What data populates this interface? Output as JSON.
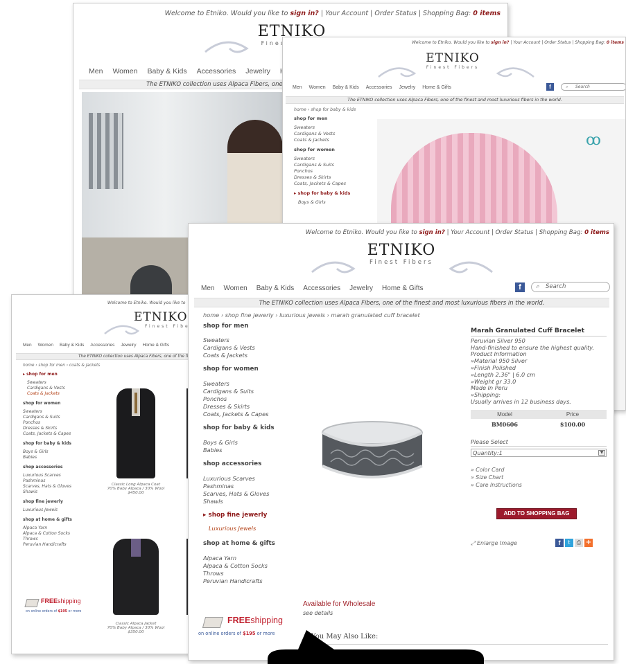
{
  "brand": {
    "name": "ETNIKO",
    "tagline": "Finest Fibers"
  },
  "topbar": {
    "welcome": "Welcome to Etniko. Would you like to",
    "signin": "sign in?",
    "account": "| Your Account | Order Status | Shopping Bag:",
    "bag_count": "0 items"
  },
  "nav": [
    "Men",
    "Women",
    "Baby & Kids",
    "Accessories",
    "Jewelry",
    "Home & Gifts"
  ],
  "search_placeholder": "Search",
  "banner": "The ETNIKO collection uses Alpaca Fibers, one of the finest and most luxurious fibers in the world.",
  "card_baby": {
    "breadcrumb": "home › shop for baby & kids",
    "sections": [
      {
        "title": "shop for men",
        "items": [
          "Sweaters",
          "Cardigans & Vests",
          "Coats & Jackets"
        ]
      },
      {
        "title": "shop for women",
        "items": [
          "Sweaters",
          "Cardigans & Suits",
          "Ponchos",
          "Dresses & Skirts",
          "Coats, Jackets & Capes"
        ]
      },
      {
        "title": "▸ shop for baby & kids",
        "items": [
          "Boys & Girls"
        ]
      }
    ]
  },
  "card_men": {
    "breadcrumb": "home › shop for men › coats & jackets",
    "sections": [
      {
        "title": "▸ shop for men",
        "items": [
          "Sweaters",
          "Cardigans & Vests",
          "Coats & Jackets"
        ]
      },
      {
        "title": "shop for women",
        "items": [
          "Sweaters",
          "Cardigans & Suits",
          "Ponchos",
          "Dresses & Skirts",
          "Coats, Jackets & Capes"
        ]
      },
      {
        "title": "shop for baby & kids",
        "items": [
          "Boys & Girls",
          "Babies"
        ]
      },
      {
        "title": "shop accessories",
        "items": [
          "Luxurious Scarves",
          "Pashminas",
          "Scarves, Hats & Gloves",
          "Shawls"
        ]
      },
      {
        "title": "shop fine jewerly",
        "items": [
          "Luxurious Jewels"
        ]
      },
      {
        "title": "shop at home & gifts",
        "items": [
          "Alpaca Yarn",
          "Alpaca & Cotton Socks",
          "Throws",
          "Peruvian Handicrafts"
        ]
      }
    ],
    "products": [
      {
        "name": "Classic Long Alpaca Coat",
        "desc": "70% Baby Alpaca / 30% Wool",
        "price": "$450.00"
      },
      {
        "name": "Classic Alpaca Jacket",
        "desc": "70% Baby Alpaca / 30% Wool",
        "price": "$350.00"
      }
    ]
  },
  "card_jewel": {
    "breadcrumb": "home › shop fine jewerly › luxurious jewels › marah granulated cuff bracelet",
    "sections": [
      {
        "title": "shop for men",
        "items": [
          "Sweaters",
          "Cardigans & Vests",
          "Coats & Jackets"
        ]
      },
      {
        "title": "shop for women",
        "items": [
          "Sweaters",
          "Cardigans & Suits",
          "Ponchos",
          "Dresses & Skirts",
          "Coats, Jackets & Capes"
        ]
      },
      {
        "title": "shop for baby & kids",
        "items": [
          "Boys & Girls",
          "Babies"
        ]
      },
      {
        "title": "shop accessories",
        "items": [
          "Luxurious Scarves",
          "Pashminas",
          "Scarves, Hats & Gloves",
          "Shawls"
        ]
      },
      {
        "title": "▸ shop fine jewerly",
        "items": [
          "Luxurious Jewels"
        ]
      },
      {
        "title": "shop at home & gifts",
        "items": [
          "Alpaca Yarn",
          "Alpaca & Cotton Socks",
          "Throws",
          "Peruvian Handicrafts"
        ]
      }
    ],
    "product": {
      "title": "Marah Granulated Cuff Bracelet",
      "lines": [
        "Peruvian Silver 950",
        "Hand-finished to ensure the highest quality.",
        "Product Information",
        "»Material 950 Silver",
        "»Finish Polished",
        "»Length 2.36\" | 6.0 cm",
        "»Weight gr 33.0",
        "Made In Peru",
        "»Shipping:",
        "Usually arrives in 12 business days."
      ],
      "col_model": "Model",
      "col_price": "Price",
      "model": "BM0606",
      "price": "$100.00",
      "please_select": "Please Select",
      "quantity": "Quantity:1",
      "links": [
        "» Color Card",
        "» Size Chart",
        "» Care Instructions"
      ],
      "add_to_bag": "ADD TO SHOPPING BAG",
      "enlarge": "Enlarge Image",
      "wholesale": "Available for Wholesale",
      "see_details": "see details",
      "also_like": "You May Also Like:"
    }
  },
  "free_shipping": {
    "free": "FREE",
    "shipping": "shipping",
    "note_prefix": "on online orders of",
    "amount": "$195",
    "note_suffix": "or more"
  },
  "colors": {
    "accent": "#8e1b1b",
    "button": "#9c1a2c",
    "facebook": "#3b5998",
    "banner_bg": "#eeeeee"
  }
}
